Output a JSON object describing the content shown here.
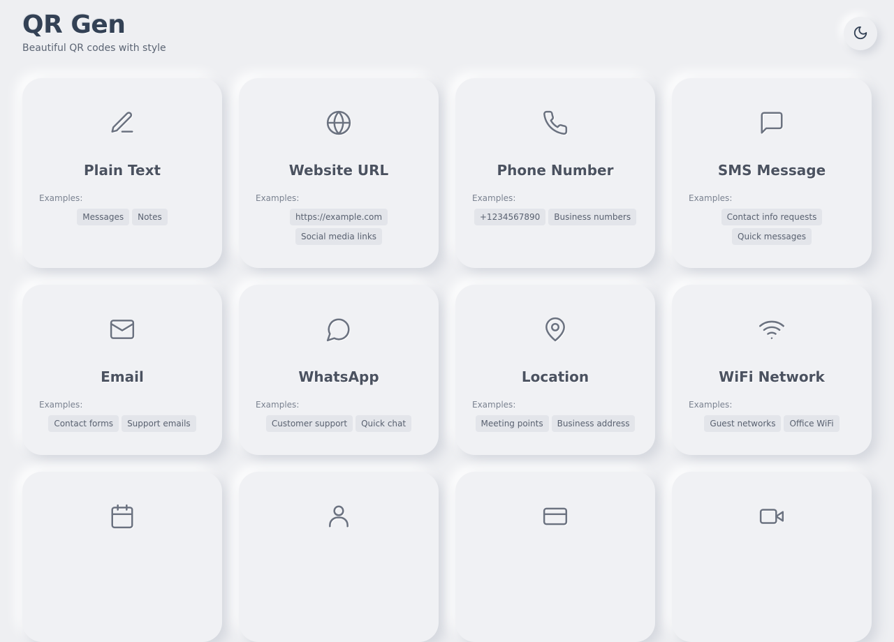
{
  "header": {
    "title": "QR Gen",
    "subtitle": "Beautiful QR codes with style"
  },
  "theme_toggle": {
    "icon": "moon-icon"
  },
  "examples_label": "Examples:",
  "cards": [
    {
      "icon": "pencil-icon",
      "title": "Plain Text",
      "examples": [
        "Messages",
        "Notes"
      ]
    },
    {
      "icon": "globe-icon",
      "title": "Website URL",
      "examples": [
        "https://example.com",
        "Social media links"
      ]
    },
    {
      "icon": "phone-icon",
      "title": "Phone Number",
      "examples": [
        "+1234567890",
        "Business numbers"
      ]
    },
    {
      "icon": "message-square-icon",
      "title": "SMS Message",
      "examples": [
        "Contact info requests",
        "Quick messages"
      ]
    },
    {
      "icon": "mail-icon",
      "title": "Email",
      "examples": [
        "Contact forms",
        "Support emails"
      ]
    },
    {
      "icon": "message-circle-icon",
      "title": "WhatsApp",
      "examples": [
        "Customer support",
        "Quick chat"
      ]
    },
    {
      "icon": "map-pin-icon",
      "title": "Location",
      "examples": [
        "Meeting points",
        "Business address"
      ]
    },
    {
      "icon": "wifi-icon",
      "title": "WiFi Network",
      "examples": [
        "Guest networks",
        "Office WiFi"
      ]
    },
    {
      "icon": "calendar-icon",
      "title": "",
      "examples": []
    },
    {
      "icon": "user-icon",
      "title": "",
      "examples": []
    },
    {
      "icon": "credit-card-icon",
      "title": "",
      "examples": []
    },
    {
      "icon": "video-icon",
      "title": "",
      "examples": []
    }
  ]
}
